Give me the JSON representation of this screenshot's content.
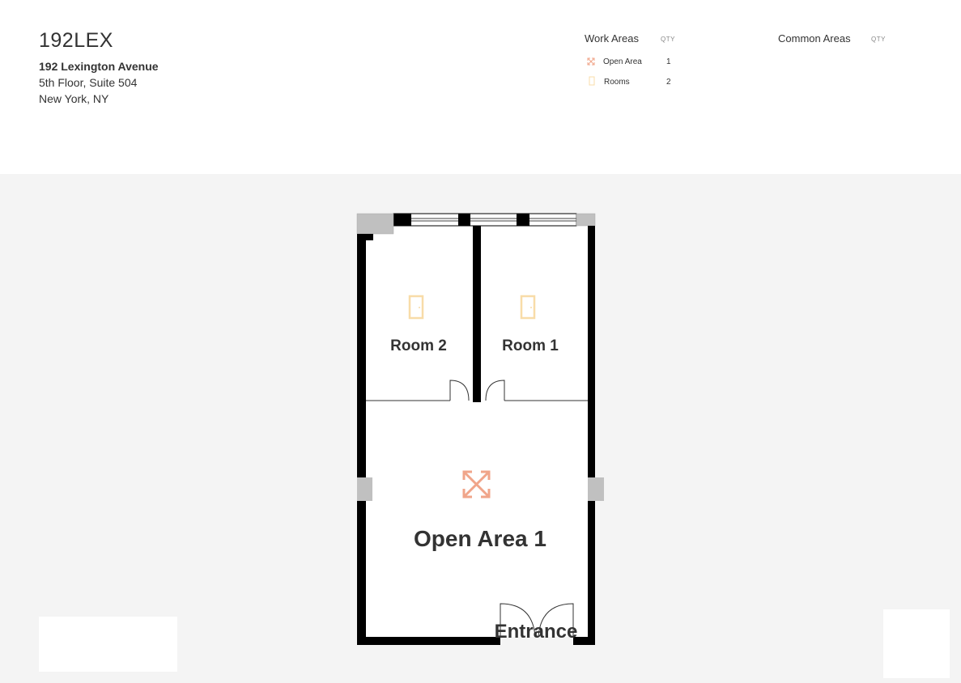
{
  "header": {
    "title": "192LEX",
    "address_line1": "192 Lexington Avenue",
    "address_line2": "5th Floor, Suite 504",
    "address_line3": "New York, NY"
  },
  "legend": {
    "work_areas": {
      "title": "Work Areas",
      "qty_label": "QTY",
      "items": [
        {
          "label": "Open Area",
          "qty": "1",
          "icon": "expand-arrows-icon",
          "color": "#f0a58a"
        },
        {
          "label": "Rooms",
          "qty": "2",
          "icon": "door-icon",
          "color": "#f8dca8"
        }
      ]
    },
    "common_areas": {
      "title": "Common Areas",
      "qty_label": "QTY"
    }
  },
  "plan": {
    "rooms": [
      {
        "label": "Room 2",
        "icon": "door-icon"
      },
      {
        "label": "Room 1",
        "icon": "door-icon"
      },
      {
        "label": "Open Area 1",
        "icon": "expand-arrows-icon"
      }
    ],
    "entrance_label": "Entrance"
  },
  "colors": {
    "wall": "#000000",
    "column": "#c0c0c0",
    "open_area_icon": "#f0a58a",
    "room_icon": "#f8dca8",
    "background": "#f4f4f4"
  }
}
